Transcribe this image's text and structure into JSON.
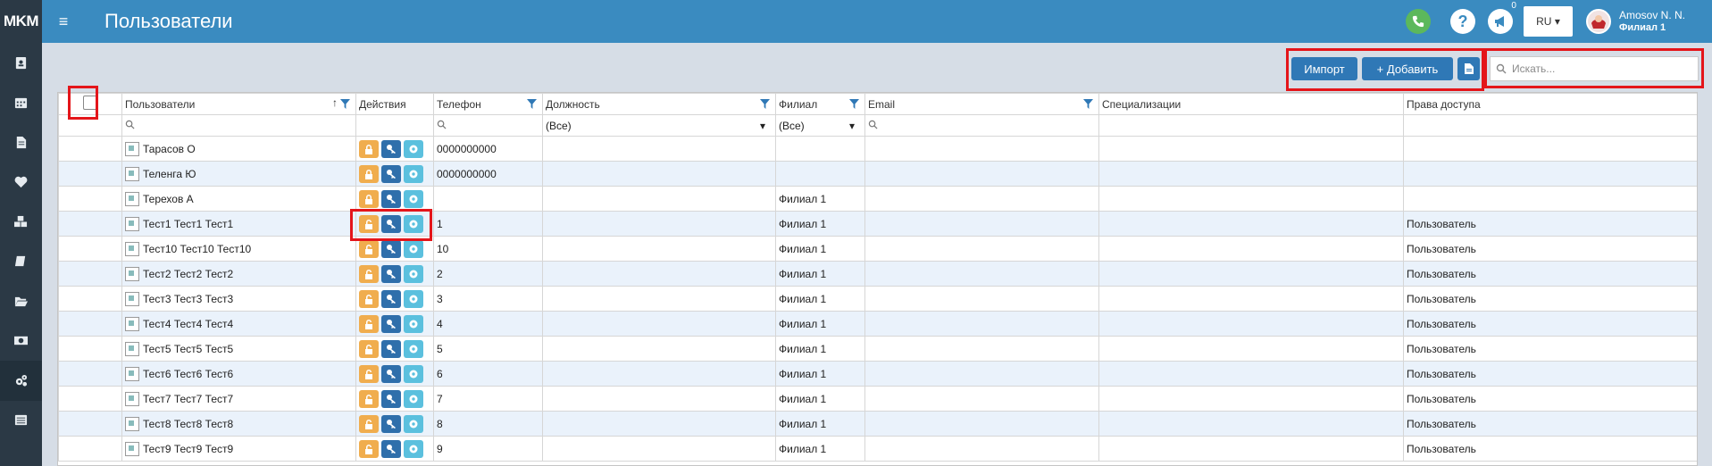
{
  "app": {
    "brand": "MKM",
    "page_title": "Пользователи"
  },
  "topbar": {
    "menu_icon": "menu-icon",
    "help_label": "?",
    "notification_count": "0",
    "language": "RU",
    "user_name": "Amosov N. N.",
    "user_branch": "Филиал 1"
  },
  "sidebar": {
    "items": [
      {
        "icon": "contacts-icon"
      },
      {
        "icon": "calendar-icon"
      },
      {
        "icon": "document-icon"
      },
      {
        "icon": "heartbeat-icon"
      },
      {
        "icon": "cubes-icon"
      },
      {
        "icon": "book-icon"
      },
      {
        "icon": "folder-open-icon"
      },
      {
        "icon": "money-icon"
      },
      {
        "icon": "cogs-icon",
        "active": true
      },
      {
        "icon": "list-icon"
      }
    ]
  },
  "toolbar": {
    "import_label": "Импорт",
    "add_label": "+ Добавить",
    "search_placeholder": "Искать..."
  },
  "grid": {
    "columns": {
      "users": "Пользователи",
      "actions": "Действия",
      "phone": "Телефон",
      "position": "Должность",
      "branch": "Филиал",
      "email": "Email",
      "specializations": "Специализации",
      "access": "Права доступа"
    },
    "filters": {
      "position": "(Все)",
      "branch": "(Все)"
    },
    "rows": [
      {
        "name": "Тарасов О",
        "phone": "0000000000",
        "branch": "",
        "access": "",
        "locked": true
      },
      {
        "name": "Теленга Ю",
        "phone": "0000000000",
        "branch": "",
        "access": "",
        "locked": true
      },
      {
        "name": "Терехов А",
        "phone": "",
        "branch": "Филиал 1",
        "access": "",
        "locked": true
      },
      {
        "name": "Тест1 Тест1 Тест1",
        "phone": "1",
        "branch": "Филиал 1",
        "access": "Пользователь",
        "locked": false
      },
      {
        "name": "Тест10 Тест10 Тест10",
        "phone": "10",
        "branch": "Филиал 1",
        "access": "Пользователь",
        "locked": false
      },
      {
        "name": "Тест2 Тест2 Тест2",
        "phone": "2",
        "branch": "Филиал 1",
        "access": "Пользователь",
        "locked": false
      },
      {
        "name": "Тест3 Тест3 Тест3",
        "phone": "3",
        "branch": "Филиал 1",
        "access": "Пользователь",
        "locked": false
      },
      {
        "name": "Тест4 Тест4 Тест4",
        "phone": "4",
        "branch": "Филиал 1",
        "access": "Пользователь",
        "locked": false
      },
      {
        "name": "Тест5 Тест5 Тест5",
        "phone": "5",
        "branch": "Филиал 1",
        "access": "Пользователь",
        "locked": false
      },
      {
        "name": "Тест6 Тест6 Тест6",
        "phone": "6",
        "branch": "Филиал 1",
        "access": "Пользователь",
        "locked": false
      },
      {
        "name": "Тест7 Тест7 Тест7",
        "phone": "7",
        "branch": "Филиал 1",
        "access": "Пользователь",
        "locked": false
      },
      {
        "name": "Тест8 Тест8 Тест8",
        "phone": "8",
        "branch": "Филиал 1",
        "access": "Пользователь",
        "locked": false
      },
      {
        "name": "Тест9 Тест9 Тест9",
        "phone": "9",
        "branch": "Филиал 1",
        "access": "Пользователь",
        "locked": false
      }
    ]
  },
  "colors": {
    "topbar": "#3a8bc0",
    "sidebar": "#2b3945",
    "highlight": "#e4151a",
    "primary_button": "#2f78b6"
  }
}
